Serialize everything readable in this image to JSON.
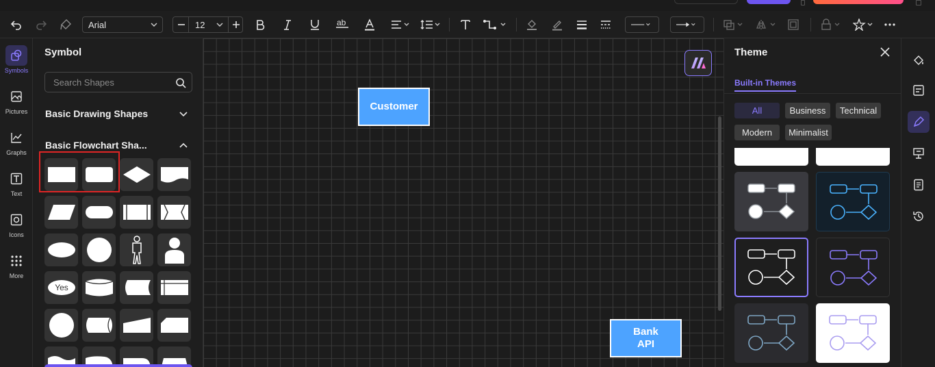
{
  "colors": {
    "accent": "#8b7bff",
    "node_fill": "#4da3ff",
    "highlight": "#e02525",
    "canvas_bg": "#1c1c1c"
  },
  "toolbar": {
    "font_family": "Arial",
    "font_size": "12",
    "icons": [
      "undo-icon",
      "redo-icon",
      "format-painter-icon",
      "decrease-font-icon",
      "increase-font-icon",
      "bold-icon",
      "italic-icon",
      "underline-icon",
      "strikethrough-icon",
      "font-color-icon",
      "align-icon",
      "line-spacing-icon",
      "text-icon",
      "connector-icon",
      "fill-icon",
      "line-color-icon",
      "line-weight-icon",
      "dash-icon",
      "line-style-icon",
      "arrow-style-icon",
      "group-icon",
      "flip-icon",
      "crop-icon",
      "lock-icon",
      "star-icon",
      "more-icon"
    ]
  },
  "left_rail": {
    "items": [
      {
        "label": "Symbols",
        "icon": "symbols-icon"
      },
      {
        "label": "Pictures",
        "icon": "pictures-icon"
      },
      {
        "label": "Graphs",
        "icon": "graphs-icon"
      },
      {
        "label": "Text",
        "icon": "text-icon"
      },
      {
        "label": "Icons",
        "icon": "icons-icon"
      },
      {
        "label": "More",
        "icon": "more-grid-icon"
      }
    ]
  },
  "symbol_panel": {
    "title": "Symbol",
    "search_placeholder": "Search Shapes",
    "sections": [
      {
        "title": "Basic Drawing Shapes",
        "expanded": false
      },
      {
        "title": "Basic Flowchart Sha...",
        "expanded": true
      }
    ],
    "yes_label": "Yes"
  },
  "canvas": {
    "nodes": [
      {
        "label": "Customer"
      },
      {
        "label": "Bank API"
      }
    ]
  },
  "theme_panel": {
    "title": "Theme",
    "tab": "Built-in Themes",
    "filters": [
      "All",
      "Business",
      "Technical",
      "Modern",
      "Minimalist"
    ],
    "active_filter": "All"
  }
}
